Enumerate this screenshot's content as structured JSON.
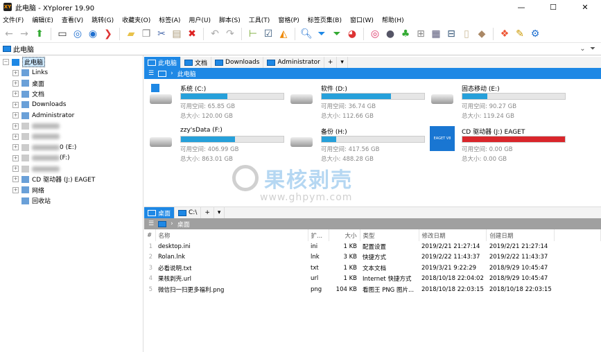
{
  "window": {
    "title": "此电脑 - XYplorer 19.90",
    "logo": "XY",
    "minimize": "—",
    "maximize": "☐",
    "close": "✕"
  },
  "menu": [
    "文件(F)",
    "编辑(E)",
    "查看(V)",
    "跳转(G)",
    "收藏夹(O)",
    "标签(A)",
    "用户(U)",
    "脚本(S)",
    "工具(T)",
    "窗格(P)",
    "标签页集(B)",
    "窗口(W)",
    "帮助(H)"
  ],
  "toolbar": [
    {
      "icon": "back-icon",
      "glyph": "←",
      "color": "#aaa"
    },
    {
      "icon": "forward-icon",
      "glyph": "→",
      "color": "#aaa"
    },
    {
      "icon": "up-icon",
      "glyph": "⬆",
      "color": "#3a3"
    },
    {
      "icon": "computer-icon",
      "glyph": "▭",
      "color": "#333"
    },
    {
      "icon": "target-icon",
      "glyph": "◎",
      "color": "#1e6fd0"
    },
    {
      "icon": "find-icon",
      "glyph": "◉",
      "color": "#1e6fd0"
    },
    {
      "icon": "goto-icon",
      "glyph": "❯",
      "color": "#d33"
    },
    {
      "icon": "new-folder-icon",
      "glyph": "▰",
      "color": "#e8c24a"
    },
    {
      "icon": "copy-icon",
      "glyph": "❐",
      "color": "#888"
    },
    {
      "icon": "cut-icon",
      "glyph": "✂",
      "color": "#46a"
    },
    {
      "icon": "paste-icon",
      "glyph": "▤",
      "color": "#a97"
    },
    {
      "icon": "delete-icon",
      "glyph": "✖",
      "color": "#d22"
    },
    {
      "icon": "undo-icon",
      "glyph": "↶",
      "color": "#aaa"
    },
    {
      "icon": "redo-icon",
      "glyph": "↷",
      "color": "#aaa"
    },
    {
      "icon": "tree-icon",
      "glyph": "⊢",
      "color": "#7a3"
    },
    {
      "icon": "checkbox-icon",
      "glyph": "☑",
      "color": "#357"
    },
    {
      "icon": "pizza-icon",
      "glyph": "◭",
      "color": "#e80"
    },
    {
      "icon": "search-icon",
      "glyph": "🔍︎",
      "color": "#1e6fd0"
    },
    {
      "icon": "filter-icon",
      "glyph": "⏷",
      "color": "#1e88e5"
    },
    {
      "icon": "green-filter-icon",
      "glyph": "⏷",
      "color": "#3a3"
    },
    {
      "icon": "pie-icon",
      "glyph": "◕",
      "color": "#d33"
    },
    {
      "icon": "spiral-icon",
      "glyph": "◎",
      "color": "#d36"
    },
    {
      "icon": "moon-icon",
      "glyph": "●",
      "color": "#556"
    },
    {
      "icon": "tree-green-icon",
      "glyph": "♣",
      "color": "#3a3"
    },
    {
      "icon": "grid-icon",
      "glyph": "⊞",
      "color": "#888"
    },
    {
      "icon": "details-icon",
      "glyph": "▦",
      "color": "#557"
    },
    {
      "icon": "dual-pane-icon",
      "glyph": "⊟",
      "color": "#357"
    },
    {
      "icon": "notebook-icon",
      "glyph": "▯",
      "color": "#cb9"
    },
    {
      "icon": "tag-icon",
      "glyph": "◆",
      "color": "#a86"
    },
    {
      "icon": "colors-icon",
      "glyph": "❖",
      "color": "#e53"
    },
    {
      "icon": "brush-icon",
      "glyph": "✎",
      "color": "#c90"
    },
    {
      "icon": "settings-icon",
      "glyph": "⚙",
      "color": "#1e6fd0"
    }
  ],
  "address": {
    "value": "此电脑"
  },
  "tree": [
    {
      "label": "此电脑",
      "selected": true,
      "expander": "−",
      "level": 0
    },
    {
      "label": "Links",
      "level": 1
    },
    {
      "label": "桌面",
      "level": 1
    },
    {
      "label": "文档",
      "level": 1
    },
    {
      "label": "Downloads",
      "level": 1
    },
    {
      "label": "Administrator",
      "level": 1
    },
    {
      "label": "",
      "blur": true,
      "level": 1
    },
    {
      "label": "",
      "blur": true,
      "level": 1
    },
    {
      "label": "0 (E:)",
      "blur": true,
      "level": 1
    },
    {
      "label": "(F:)",
      "blur": true,
      "level": 1
    },
    {
      "label": "",
      "blur": true,
      "level": 1
    },
    {
      "label": "CD 驱动器 (J:) EAGET",
      "level": 1
    },
    {
      "label": "网络",
      "level": 1
    },
    {
      "label": "回收站",
      "level": 1,
      "noexp": true
    }
  ],
  "top_pane": {
    "tabs": [
      "此电脑",
      "文档",
      "Downloads",
      "Administrator"
    ],
    "add": "+",
    "breadcrumb": "此电脑",
    "drives": [
      {
        "name": "系统 (C:)",
        "free": "可用空间: 65.85 GB",
        "total": "总大小: 120.00 GB",
        "used": 0.451,
        "type": "system"
      },
      {
        "name": "软件 (D:)",
        "free": "可用空间: 36.74 GB",
        "total": "总大小: 112.66 GB",
        "used": 0.674
      },
      {
        "name": "固态移动 (E:)",
        "free": "可用空间: 90.27 GB",
        "total": "总大小: 119.24 GB",
        "used": 0.243
      },
      {
        "name": "zzy'sData (F:)",
        "free": "可用空间: 406.99 GB",
        "total": "总大小: 863.01 GB",
        "used": 0.528
      },
      {
        "name": "备份 (H:)",
        "free": "可用空间: 417.56 GB",
        "total": "总大小: 488.28 GB",
        "used": 0.145
      },
      {
        "name": "CD 驱动器 (J:) EAGET",
        "free": "可用空间: 0.00 GB",
        "total": "总大小: 0.00 GB",
        "used": 1.0,
        "type": "cd",
        "bar_color": "#d9262b",
        "logo": "EAGET V8"
      }
    ]
  },
  "watermark": {
    "text": "果核剥壳",
    "url": "www.ghpym.com"
  },
  "bottom_pane": {
    "tabs": [
      "桌面",
      "C:\\"
    ],
    "add": "+",
    "breadcrumb": "桌面",
    "columns": [
      "#",
      "名称",
      "扩...",
      "大小",
      "类型",
      "修改日期",
      "创建日期"
    ],
    "rows": [
      [
        "1",
        "desktop.ini",
        "ini",
        "1 KB",
        "配置设置",
        "2019/2/21 21:27:14",
        "2019/2/21 21:27:14"
      ],
      [
        "2",
        "Rolan.lnk",
        "lnk",
        "3 KB",
        "快捷方式",
        "2019/2/22 11:43:37",
        "2019/2/22 11:43:37"
      ],
      [
        "3",
        "必看说明.txt",
        "txt",
        "1 KB",
        "文本文档",
        "2019/3/21 9:22:29",
        "2018/9/29 10:45:47"
      ],
      [
        "4",
        "果核剥壳.url",
        "url",
        "1 KB",
        "Internet 快捷方式",
        "2018/10/18 22:04:02",
        "2018/9/29 10:45:47"
      ],
      [
        "5",
        "微信扫一扫更多福利.png",
        "png",
        "104 KB",
        "看图王 PNG 图片...",
        "2018/10/18 22:03:15",
        "2018/10/18 22:03:15"
      ]
    ]
  },
  "colors": {
    "accent": "#1e88e5",
    "disk_bar": "#26a0da",
    "disk_full": "#d9262b",
    "inactive_bar": "#a0a0a0"
  }
}
